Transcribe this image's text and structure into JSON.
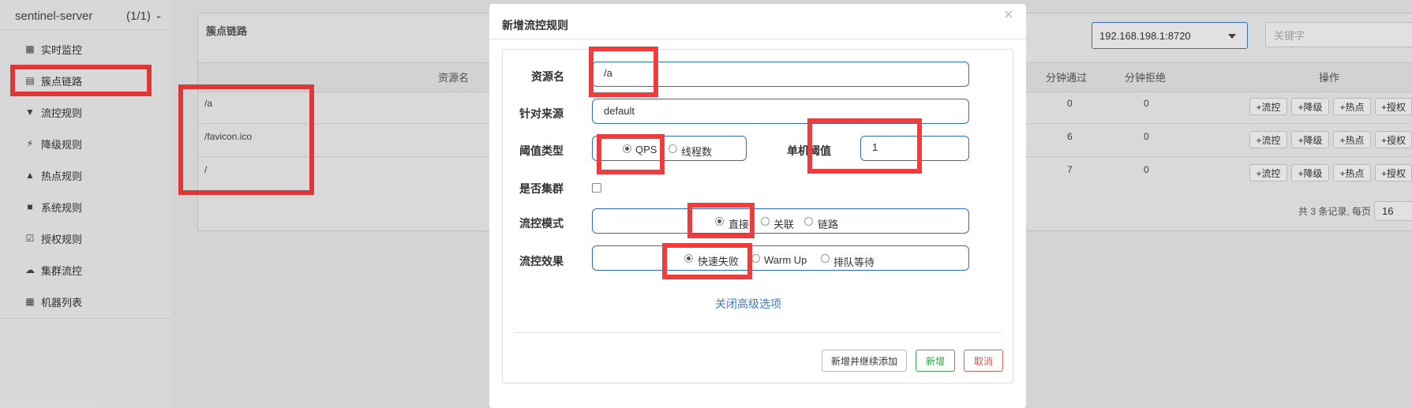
{
  "sidebar": {
    "app_name": "sentinel-server",
    "app_count": "(1/1)",
    "items": [
      {
        "label": "实时监控",
        "icon": "bar-chart-icon"
      },
      {
        "label": "簇点链路",
        "icon": "list-icon"
      },
      {
        "label": "流控规则",
        "icon": "filter-icon"
      },
      {
        "label": "降级规则",
        "icon": "flash-icon"
      },
      {
        "label": "热点规则",
        "icon": "fire-icon"
      },
      {
        "label": "系统规则",
        "icon": "lock-icon"
      },
      {
        "label": "授权规则",
        "icon": "check-square-icon"
      },
      {
        "label": "集群流控",
        "icon": "cloud-icon"
      },
      {
        "label": "机器列表",
        "icon": "grid-icon"
      }
    ]
  },
  "panel": {
    "title": "簇点链路",
    "machine_select": "192.168.198.1:8720",
    "keyword_placeholder": "关键字",
    "columns": {
      "resource": "资源名",
      "pass": "分钟通过",
      "block": "分钟拒绝",
      "ops": "操作"
    },
    "rows": [
      {
        "resource": "/a",
        "pass": "0",
        "block": "0"
      },
      {
        "resource": "/favicon.ico",
        "pass": "6",
        "block": "0"
      },
      {
        "resource": "/",
        "pass": "7",
        "block": "0"
      }
    ],
    "row_buttons": [
      "+流控",
      "+降级",
      "+热点",
      "+授权"
    ],
    "pager_text": "共 3 条记录, 每页",
    "page_size": "16"
  },
  "modal": {
    "title": "新增流控规则",
    "close": "×",
    "resource_label": "资源名",
    "resource_value": "/a",
    "limit_app_label": "针对来源",
    "limit_app_value": "default",
    "grade_label": "阈值类型",
    "grade_options": [
      "QPS",
      "线程数"
    ],
    "threshold_label": "单机阈值",
    "threshold_value": "1",
    "cluster_label": "是否集群",
    "strategy_label": "流控模式",
    "strategy_options": [
      "直接",
      "关联",
      "链路"
    ],
    "effect_label": "流控效果",
    "effect_options": [
      "快速失败",
      "Warm Up",
      "排队等待"
    ],
    "advanced_link": "关闭高级选项",
    "btn_add_continue": "新增并继续添加",
    "btn_add": "新增",
    "btn_cancel": "取消"
  },
  "colors": {
    "accent": "#3a7cc9",
    "highlight": "#f03c3c",
    "success": "#2e9e44",
    "danger": "#d9534f"
  }
}
